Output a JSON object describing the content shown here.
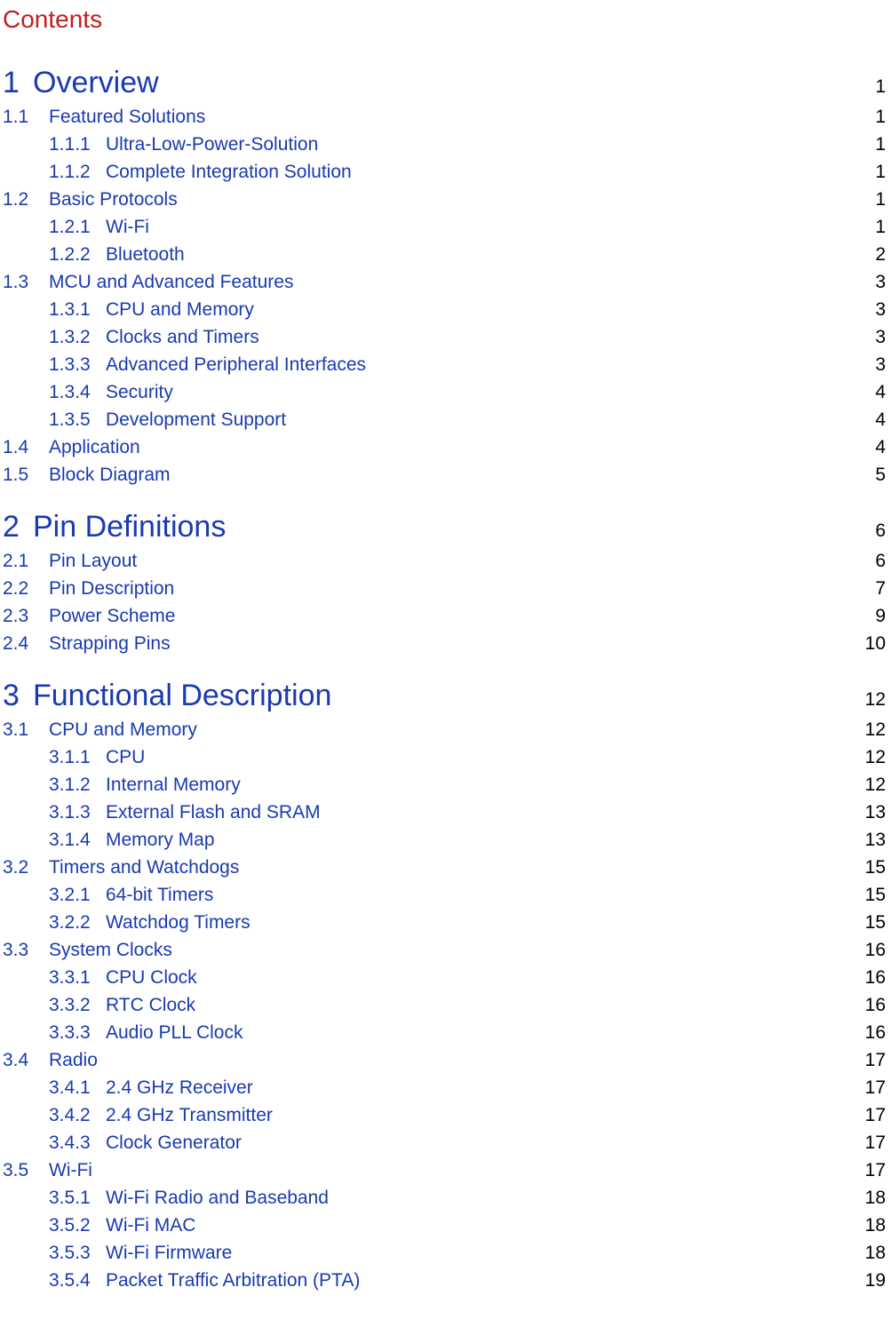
{
  "pageTitle": "Contents",
  "toc": [
    {
      "num": "1",
      "title": "Overview",
      "page": "1",
      "sections": [
        {
          "num": "1.1",
          "title": "Featured Solutions",
          "page": "1",
          "subs": [
            {
              "num": "1.1.1",
              "title": "Ultra-Low-Power-Solution",
              "page": "1"
            },
            {
              "num": "1.1.2",
              "title": "Complete Integration Solution",
              "page": "1"
            }
          ]
        },
        {
          "num": "1.2",
          "title": "Basic Protocols",
          "page": "1",
          "subs": [
            {
              "num": "1.2.1",
              "title": "Wi-Fi",
              "page": "1"
            },
            {
              "num": "1.2.2",
              "title": "Bluetooth",
              "page": "2"
            }
          ]
        },
        {
          "num": "1.3",
          "title": "MCU and Advanced Features",
          "page": "3",
          "subs": [
            {
              "num": "1.3.1",
              "title": "CPU and Memory",
              "page": "3"
            },
            {
              "num": "1.3.2",
              "title": "Clocks and Timers",
              "page": "3"
            },
            {
              "num": "1.3.3",
              "title": "Advanced Peripheral Interfaces",
              "page": "3"
            },
            {
              "num": "1.3.4",
              "title": "Security",
              "page": "4"
            },
            {
              "num": "1.3.5",
              "title": "Development Support",
              "page": "4"
            }
          ]
        },
        {
          "num": "1.4",
          "title": "Application",
          "page": "4",
          "subs": []
        },
        {
          "num": "1.5",
          "title": "Block Diagram",
          "page": "5",
          "subs": []
        }
      ]
    },
    {
      "num": "2",
      "title": "Pin Definitions",
      "page": "6",
      "sections": [
        {
          "num": "2.1",
          "title": "Pin Layout",
          "page": "6",
          "subs": []
        },
        {
          "num": "2.2",
          "title": "Pin Description",
          "page": "7",
          "subs": []
        },
        {
          "num": "2.3",
          "title": "Power Scheme",
          "page": "9",
          "subs": []
        },
        {
          "num": "2.4",
          "title": "Strapping Pins",
          "page": "10",
          "subs": []
        }
      ]
    },
    {
      "num": "3",
      "title": "Functional Description",
      "page": "12",
      "sections": [
        {
          "num": "3.1",
          "title": "CPU and Memory",
          "page": "12",
          "subs": [
            {
              "num": "3.1.1",
              "title": "CPU",
              "page": "12"
            },
            {
              "num": "3.1.2",
              "title": "Internal Memory",
              "page": "12"
            },
            {
              "num": "3.1.3",
              "title": "External Flash and SRAM",
              "page": "13"
            },
            {
              "num": "3.1.4",
              "title": "Memory Map",
              "page": "13"
            }
          ]
        },
        {
          "num": "3.2",
          "title": "Timers and Watchdogs",
          "page": "15",
          "subs": [
            {
              "num": "3.2.1",
              "title": "64-bit Timers",
              "page": "15"
            },
            {
              "num": "3.2.2",
              "title": "Watchdog Timers",
              "page": "15"
            }
          ]
        },
        {
          "num": "3.3",
          "title": "System Clocks",
          "page": "16",
          "subs": [
            {
              "num": "3.3.1",
              "title": "CPU Clock",
              "page": "16"
            },
            {
              "num": "3.3.2",
              "title": "RTC Clock",
              "page": "16"
            },
            {
              "num": "3.3.3",
              "title": "Audio PLL Clock",
              "page": "16"
            }
          ]
        },
        {
          "num": "3.4",
          "title": "Radio",
          "page": "17",
          "subs": [
            {
              "num": "3.4.1",
              "title": "2.4 GHz Receiver",
              "page": "17"
            },
            {
              "num": "3.4.2",
              "title": "2.4 GHz Transmitter",
              "page": "17"
            },
            {
              "num": "3.4.3",
              "title": "Clock Generator",
              "page": "17"
            }
          ]
        },
        {
          "num": "3.5",
          "title": "Wi-Fi",
          "page": "17",
          "subs": [
            {
              "num": "3.5.1",
              "title": "Wi-Fi Radio and Baseband",
              "page": "18"
            },
            {
              "num": "3.5.2",
              "title": "Wi-Fi MAC",
              "page": "18"
            },
            {
              "num": "3.5.3",
              "title": "Wi-Fi Firmware",
              "page": "18"
            },
            {
              "num": "3.5.4",
              "title": "Packet Traffic Arbitration (PTA)",
              "page": "19"
            }
          ]
        }
      ]
    }
  ]
}
